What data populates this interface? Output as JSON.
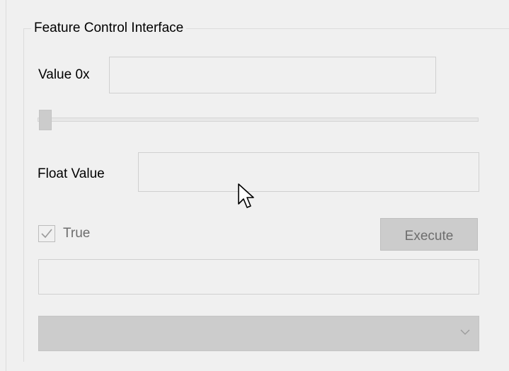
{
  "group": {
    "title": "Feature Control Interface"
  },
  "hex_value": {
    "label": "Value 0x",
    "value": "",
    "placeholder": ""
  },
  "slider": {
    "value": 0
  },
  "float_value": {
    "label": "Float Value",
    "value": "",
    "placeholder": ""
  },
  "checkbox": {
    "label": "True",
    "checked": true,
    "enabled": false
  },
  "execute_button": {
    "label": "Execute",
    "enabled": false
  },
  "result_field": {
    "value": "",
    "placeholder": ""
  },
  "dropdown": {
    "selected": "",
    "enabled": false,
    "arrow_icon": "chevron-down-icon"
  },
  "colors": {
    "background": "#f0f0f0",
    "disabled_fill": "#cccccc",
    "border": "#d0d0d0",
    "disabled_text": "#6d6d6d"
  }
}
